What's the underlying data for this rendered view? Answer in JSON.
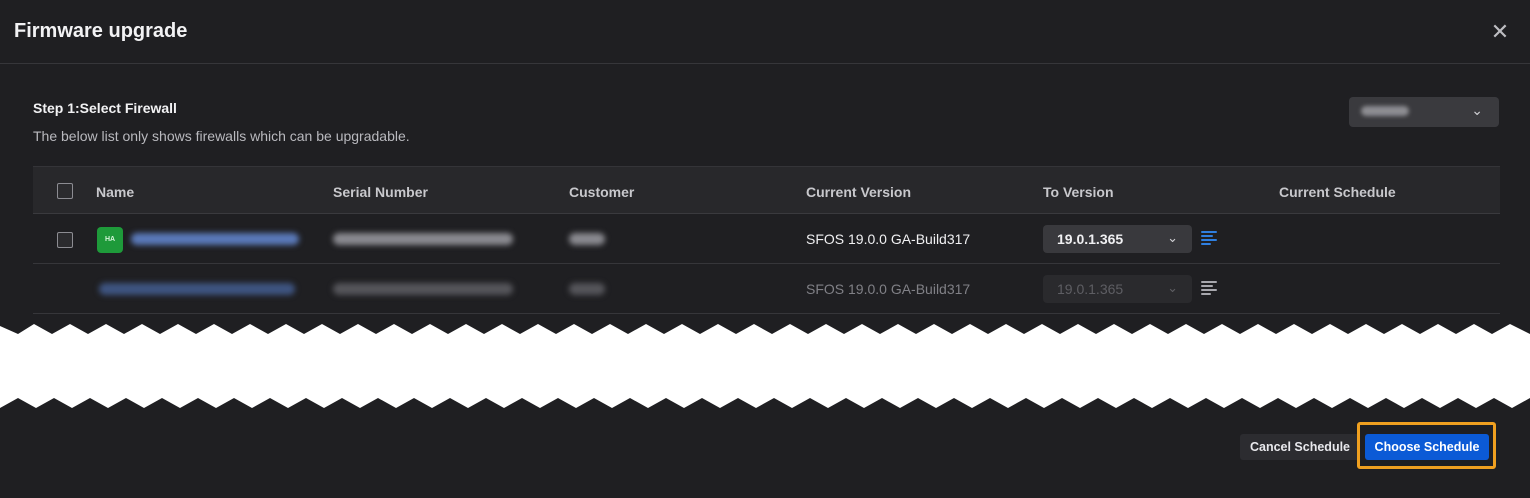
{
  "dialog": {
    "title": "Firmware upgrade",
    "close_icon": "close-icon"
  },
  "step": {
    "title": "Step 1:Select Firewall",
    "description": "The below list only shows firewalls which can be upgradable."
  },
  "filter_select": {
    "value": "",
    "icon": "chevron-down-icon"
  },
  "table": {
    "columns": [
      "Name",
      "Serial Number",
      "Customer",
      "Current Version",
      "To Version",
      "Current Schedule"
    ],
    "rows": [
      {
        "badge": "HA",
        "current_version": "SFOS 19.0.0 GA-Build317",
        "to_version": "19.0.1.365",
        "disabled": false
      },
      {
        "current_version": "SFOS 19.0.0 GA-Build317",
        "to_version": "19.0.1.365",
        "disabled": true
      }
    ]
  },
  "footer": {
    "cancel_label": "Cancel Schedule",
    "choose_label": "Choose Schedule"
  },
  "colors": {
    "primary": "#0b5ad6",
    "highlight": "#f0a020",
    "ha_badge": "#1e9a3a",
    "schedule_icon": "#2f7fe0"
  }
}
